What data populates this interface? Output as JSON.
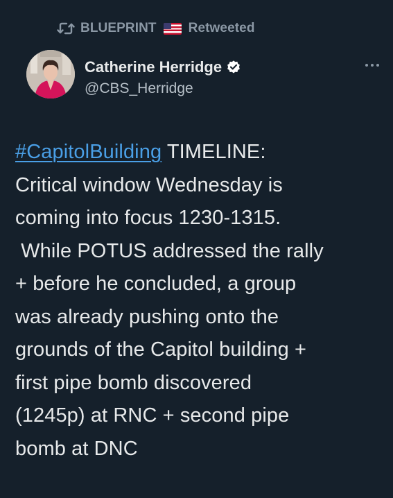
{
  "retweet": {
    "account": "BLUEPRINT",
    "flag_icon": "us-flag-icon",
    "label": "Retweeted"
  },
  "author": {
    "display_name": "Catherine Herridge",
    "handle": "@CBS_Herridge",
    "verified": true
  },
  "tweet": {
    "hashtag": "#CapitolBuilding",
    "body": " TIMELINE:\nCritical window Wednesday is\ncoming into focus 1230-1315.\n While POTUS addressed the rally\n+ before he concluded, a group\nwas already pushing onto the\ngrounds of the Capitol building +\nfirst pipe bomb discovered\n(1245p) at RNC + second pipe\nbomb at DNC"
  },
  "colors": {
    "background": "#15202b",
    "text": "#e7e9ea",
    "secondary": "#8b98a5",
    "link": "#4a9fe6",
    "verified_badge": "#ffffff"
  }
}
